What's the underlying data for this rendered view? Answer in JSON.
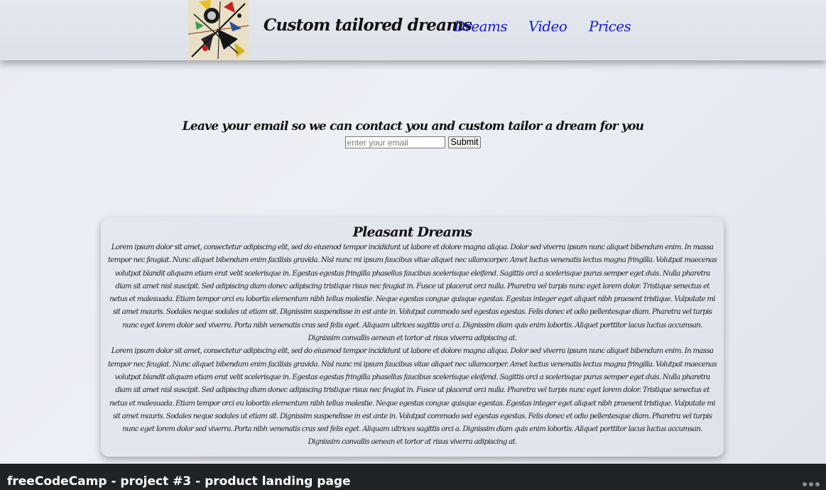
{
  "header": {
    "logo_name": "abstract-painting-logo",
    "brand": "Custom tailored dreams",
    "nav": [
      {
        "label": "Dreams"
      },
      {
        "label": "Video"
      },
      {
        "label": "Prices"
      }
    ]
  },
  "form": {
    "heading": "Leave your email so we can contact you and custom tailor a dream for you",
    "email_placeholder": "enter your email",
    "email_value": "",
    "submit_label": "Submit"
  },
  "card": {
    "title": "Pleasant Dreams",
    "paragraphs": [
      "Lorem ipsum dolor sit amet, consectetur adipiscing elit, sed do eiusmod tempor incididunt ut labore et dolore magna aliqua. Dolor sed viverra ipsum nunc aliquet bibendum enim. In massa tempor nec feugiat. Nunc aliquet bibendum enim facilisis gravida. Nisl nunc mi ipsum faucibus vitae aliquet nec ullamcorper. Amet luctus venenatis lectus magna fringilla. Volutpat maecenas volutpat blandit aliquam etiam erat velit scelerisque in. Egestas egestas fringilla phasellus faucibus scelerisque eleifend. Sagittis orci a scelerisque purus semper eget duis. Nulla pharetra diam sit amet nisl suscipit. Sed adipiscing diam donec adipiscing tristique risus nec feugiat in. Fusce ut placerat orci nulla. Pharetra vel turpis nunc eget lorem dolor. Tristique senectus et netus et malesuada. Etiam tempor orci eu lobortis elementum nibh tellus molestie. Neque egestas congue quisque egestas. Egestas integer eget aliquet nibh praesent tristique. Vulputate mi sit amet mauris. Sodales neque sodales ut etiam sit. Dignissim suspendisse in est ante in. Volutpat commodo sed egestas egestas. Felis donec et odio pellentesque diam. Pharetra vel turpis nunc eget lorem dolor sed viverra. Porta nibh venenatis cras sed felis eget. Aliquam ultrices sagittis orci a. Dignissim diam quis enim lobortis. Aliquet porttitor lacus luctus accumsan. Dignissim convallis aenean et tortor at risus viverra adipiscing at.",
      "Lorem ipsum dolor sit amet, consectetur adipiscing elit, sed do eiusmod tempor incididunt ut labore et dolore magna aliqua. Dolor sed viverra ipsum nunc aliquet bibendum enim. In massa tempor nec feugiat. Nunc aliquet bibendum enim facilisis gravida. Nisl nunc mi ipsum faucibus vitae aliquet nec ullamcorper. Amet luctus venenatis lectus magna fringilla. Volutpat maecenas volutpat blandit aliquam etiam erat velit scelerisque in. Egestas egestas fringilla phasellus faucibus scelerisque eleifend. Sagittis orci a scelerisque purus semper eget duis. Nulla pharetra diam sit amet nisl suscipit. Sed adipiscing diam donec adipiscing tristique risus nec feugiat in. Fusce ut placerat orci nulla. Pharetra vel turpis nunc eget lorem dolor. Tristique senectus et netus et malesuada. Etiam tempor orci eu lobortis elementum nibh tellus molestie. Neque egestas congue quisque egestas. Egestas integer eget aliquet nibh praesent tristique. Vulputate mi sit amet mauris. Sodales neque sodales ut etiam sit. Dignissim suspendisse in est ante in. Volutpat commodo sed egestas egestas. Felis donec et odio pellentesque diam. Pharetra vel turpis nunc eget lorem dolor sed viverra. Porta nibh venenatis cras sed felis eget. Aliquam ultrices sagittis orci a. Dignissim diam quis enim lobortis. Aliquet porttitor lacus luctus accumsan. Dignissim convallis aenean et tortor at risus viverra adipiscing at."
    ]
  },
  "bottom_bar": {
    "title": "freeCodeCamp - project #3 - product landing page",
    "menu_icon": "more-dots-icon"
  },
  "colors": {
    "nav_link": "#1a1ad0",
    "bottom_bar": "#202326"
  }
}
